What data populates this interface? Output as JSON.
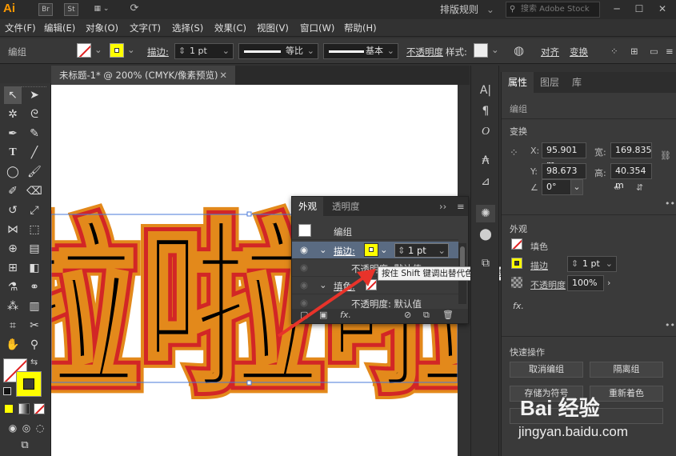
{
  "titlebar": {
    "app_logo": "Ai",
    "icons": [
      "Br",
      "St",
      "▦ ⌄",
      "⟳"
    ],
    "workspace": "排版规则",
    "search_placeholder": "搜索 Adobe Stock",
    "window_controls": [
      "─",
      "☐",
      "✕"
    ]
  },
  "menubar": {
    "items": [
      "文件(F)",
      "编辑(E)",
      "对象(O)",
      "文字(T)",
      "选择(S)",
      "效果(C)",
      "视图(V)",
      "窗口(W)",
      "帮助(H)"
    ]
  },
  "controlbar": {
    "selection_label": "编组",
    "stroke_label": "描边:",
    "stroke_weight": "1 pt",
    "profile_label": "等比",
    "brush_label": "基本",
    "opacity_label": "不透明度",
    "style_label": "样式:",
    "align_label": "对齐",
    "transform_label": "变换"
  },
  "document": {
    "tab_title": "未标题-1* @ 200% (CMYK/像素预览)",
    "close_glyph": "✕",
    "artwork_text": "啦啦啦"
  },
  "toolbar": {
    "tools": [
      "selection-tool",
      "direct-selection-tool",
      "magic-wand-tool",
      "lasso-tool",
      "pen-tool",
      "curvature-tool",
      "type-tool",
      "line-tool",
      "ellipse-tool",
      "paintbrush-tool",
      "shaper-tool",
      "eraser-tool",
      "rotate-tool",
      "scale-tool",
      "width-tool",
      "free-transform-tool",
      "shape-builder-tool",
      "perspective-grid-tool",
      "mesh-tool",
      "gradient-tool",
      "eyedropper-tool",
      "blend-tool",
      "symbol-sprayer-tool",
      "column-graph-tool",
      "artboard-tool",
      "slice-tool",
      "hand-tool",
      "zoom-tool"
    ],
    "fill_color": "#ffffff",
    "stroke_color": "#ffff00"
  },
  "appearance_panel": {
    "tab_active": "外观",
    "tab_other": "透明度",
    "menu_glyph": "≡",
    "collapse_glyph": "››",
    "rows": [
      {
        "label": "编组"
      },
      {
        "label": "描边:",
        "weight": "1 pt"
      },
      {
        "label": "不透明度: 默认值"
      },
      {
        "label": "填色:"
      },
      {
        "label": "不透明度: 默认值"
      }
    ],
    "tooltip": "按住 Shift 键调出替代色彩用户界面"
  },
  "properties_panel": {
    "tabs": [
      "属性",
      "图层",
      "库"
    ],
    "object_type": "编组",
    "transform_header": "变换",
    "x_label": "X:",
    "x_value": "95.901 m",
    "y_label": "Y:",
    "y_value": "98.673 m",
    "w_label": "宽:",
    "w_value": "169.835",
    "h_label": "高:",
    "h_value": "40.354 m",
    "angle_value": "0°",
    "appearance_header": "外观",
    "fill_label": "填色",
    "stroke_label": "描边",
    "stroke_weight": "1 pt",
    "opacity_label": "不透明度",
    "opacity_value": "100%",
    "fx_label": "fx.",
    "quick_actions_header": "快速操作",
    "buttons": [
      "取消编组",
      "隔离组",
      "存储为符号",
      "重新着色"
    ]
  },
  "watermark": {
    "brand": "Bai 经验",
    "url": "jingyan.baidu.com"
  },
  "colors": {
    "stroke_yellow": "#ffff00",
    "outline_orange": "#e3891b",
    "outline_red": "#d22626",
    "selection_blue": "#4a78d8"
  }
}
